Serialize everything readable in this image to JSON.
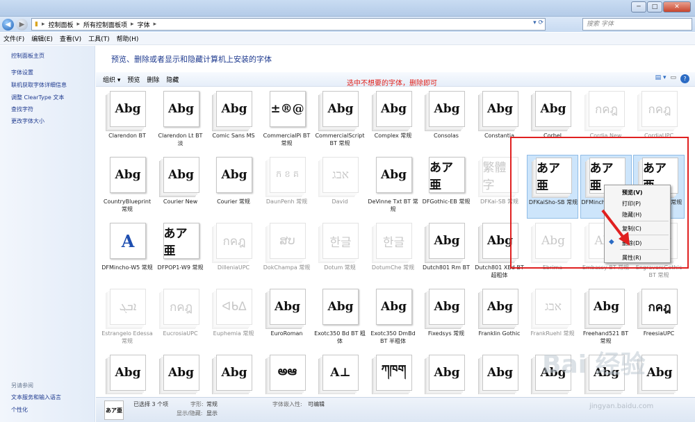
{
  "window": {
    "controls": [
      "─",
      "□",
      "✕"
    ]
  },
  "nav": {
    "back_icon": "back-arrow-icon",
    "forward_icon": "forward-arrow-icon"
  },
  "address": {
    "crumbs": [
      "控制面板",
      "所有控制面板项",
      "字体"
    ]
  },
  "search": {
    "placeholder": "搜索 字体"
  },
  "menu": [
    "文件(F)",
    "编辑(E)",
    "查看(V)",
    "工具(T)",
    "帮助(H)"
  ],
  "sidebar": {
    "home": "控制面板主页",
    "links": [
      "字体设置",
      "联机获取字体详细信息",
      "调整 ClearType 文本",
      "查找字符",
      "更改字体大小"
    ],
    "see_also_title": "另请参阅",
    "see_also": [
      "文本服务和输入语言",
      "个性化"
    ]
  },
  "heading": "预览、删除或者显示和隐藏计算机上安装的字体",
  "toolbar": {
    "organize": "组织 ▾",
    "preview": "预览",
    "delete": "删除",
    "hide": "隐藏"
  },
  "fonts": [
    [
      {
        "name": "Clarendon BT",
        "sample": "Abg"
      },
      {
        "name": "Clarendon Lt BT 淡",
        "sample": "Abg"
      },
      {
        "name": "Comic Sans MS",
        "sample": "Abg"
      },
      {
        "name": "CommercialPi BT 常规",
        "sample": "±®@"
      },
      {
        "name": "CommercialScript BT 常规",
        "sample": "Abg"
      },
      {
        "name": "Complex 常规",
        "sample": "Abg"
      },
      {
        "name": "Consolas",
        "sample": "Abg"
      },
      {
        "name": "Constantia",
        "sample": "Abg"
      },
      {
        "name": "Corbel",
        "sample": "Abg"
      },
      {
        "name": "Cordia New",
        "sample": "กคฎ"
      },
      {
        "name": "CordiaUPC",
        "sample": "กคฎ"
      }
    ],
    [
      {
        "name": "CountryBlueprint 常规",
        "sample": "Abg"
      },
      {
        "name": "Courier New",
        "sample": "Abg"
      },
      {
        "name": "Courier 常规",
        "sample": "Abg"
      },
      {
        "name": "DaunPenh 常规",
        "sample": "ក ខ គ"
      },
      {
        "name": "David",
        "sample": "אבג"
      },
      {
        "name": "DeVinne Txt BT 常规",
        "sample": "Abg"
      },
      {
        "name": "DFGothic-EB 常规",
        "sample": "あア亜"
      },
      {
        "name": "DFKai-SB 常规",
        "sample": "繁體字"
      },
      {
        "name": "DFKaiSho-SB 常规",
        "sample": "あア亜"
      },
      {
        "name": "DFMincho-UB 常规",
        "sample": "あア亜"
      },
      {
        "name": "DFPOP1-UB 常规",
        "sample": "あア亜"
      }
    ],
    [
      {
        "name": "DFMincho-W5 常规",
        "sample": "A"
      },
      {
        "name": "DFPOP1-W9 常规",
        "sample": "あア亜"
      },
      {
        "name": "DilleniaUPC",
        "sample": "กคฎ"
      },
      {
        "name": "DokChampa 常规",
        "sample": "ສບ"
      },
      {
        "name": "Dotum 常规",
        "sample": "한글"
      },
      {
        "name": "DotumChe 常规",
        "sample": "한글"
      },
      {
        "name": "Dutch801 Rm BT",
        "sample": "Abg"
      },
      {
        "name": "Dutch801 XBd BT 超粗体",
        "sample": "Abg"
      },
      {
        "name": "Ebrima",
        "sample": "Abg"
      },
      {
        "name": "Embassy BT 常规",
        "sample": "Abg"
      },
      {
        "name": "EngraversGothic BT 常规",
        "sample": "Abg"
      }
    ],
    [
      {
        "name": "Estrangelo Edessa 常规",
        "sample": "ܐܒܓ"
      },
      {
        "name": "EucrosiaUPC",
        "sample": "กคฎ"
      },
      {
        "name": "Euphemia 常规",
        "sample": "ᐊᑲᐃ"
      },
      {
        "name": "EuroRoman",
        "sample": "Abg"
      },
      {
        "name": "Exotc350 Bd BT 粗体",
        "sample": "Abg"
      },
      {
        "name": "Exotc350 DmBd BT 半粗体",
        "sample": "Abg"
      },
      {
        "name": "Fixedsys 常规",
        "sample": "Abg"
      },
      {
        "name": "Franklin Gothic",
        "sample": "Abg"
      },
      {
        "name": "FrankRuehl 常规",
        "sample": "אבג"
      },
      {
        "name": "Freehand521 BT 常规",
        "sample": "Abg"
      },
      {
        "name": "FreesiaUPC",
        "sample": "กคฎ"
      }
    ],
    [
      {
        "name": "",
        "sample": "Abg"
      },
      {
        "name": "",
        "sample": "Abg"
      },
      {
        "name": "",
        "sample": "Abg"
      },
      {
        "name": "",
        "sample": "అఆ"
      },
      {
        "name": "",
        "sample": "A⊥"
      },
      {
        "name": "",
        "sample": "ཀཁག"
      },
      {
        "name": "",
        "sample": "Abg"
      },
      {
        "name": "",
        "sample": "Abg"
      },
      {
        "name": "",
        "sample": "Abg"
      },
      {
        "name": "",
        "sample": "Abg"
      },
      {
        "name": "",
        "sample": "Abg"
      }
    ]
  ],
  "annotation": "选中不想要的字体，删除即可",
  "context_menu": [
    "预览(V)",
    "打印(P)",
    "隐藏(H)",
    "复制(C)",
    "删除(D)",
    "属性(R)"
  ],
  "status": {
    "selected": "已选择 3 个项",
    "style_label": "字形:",
    "style_value": "常规",
    "embed_label": "字体嵌入性:",
    "embed_value": "可编辑",
    "show_label": "显示/隐藏:",
    "show_value": "显示",
    "thumb_sample": "あア亜"
  },
  "watermark": {
    "text": "Bai 经验",
    "url": "jingyan.baidu.com"
  }
}
